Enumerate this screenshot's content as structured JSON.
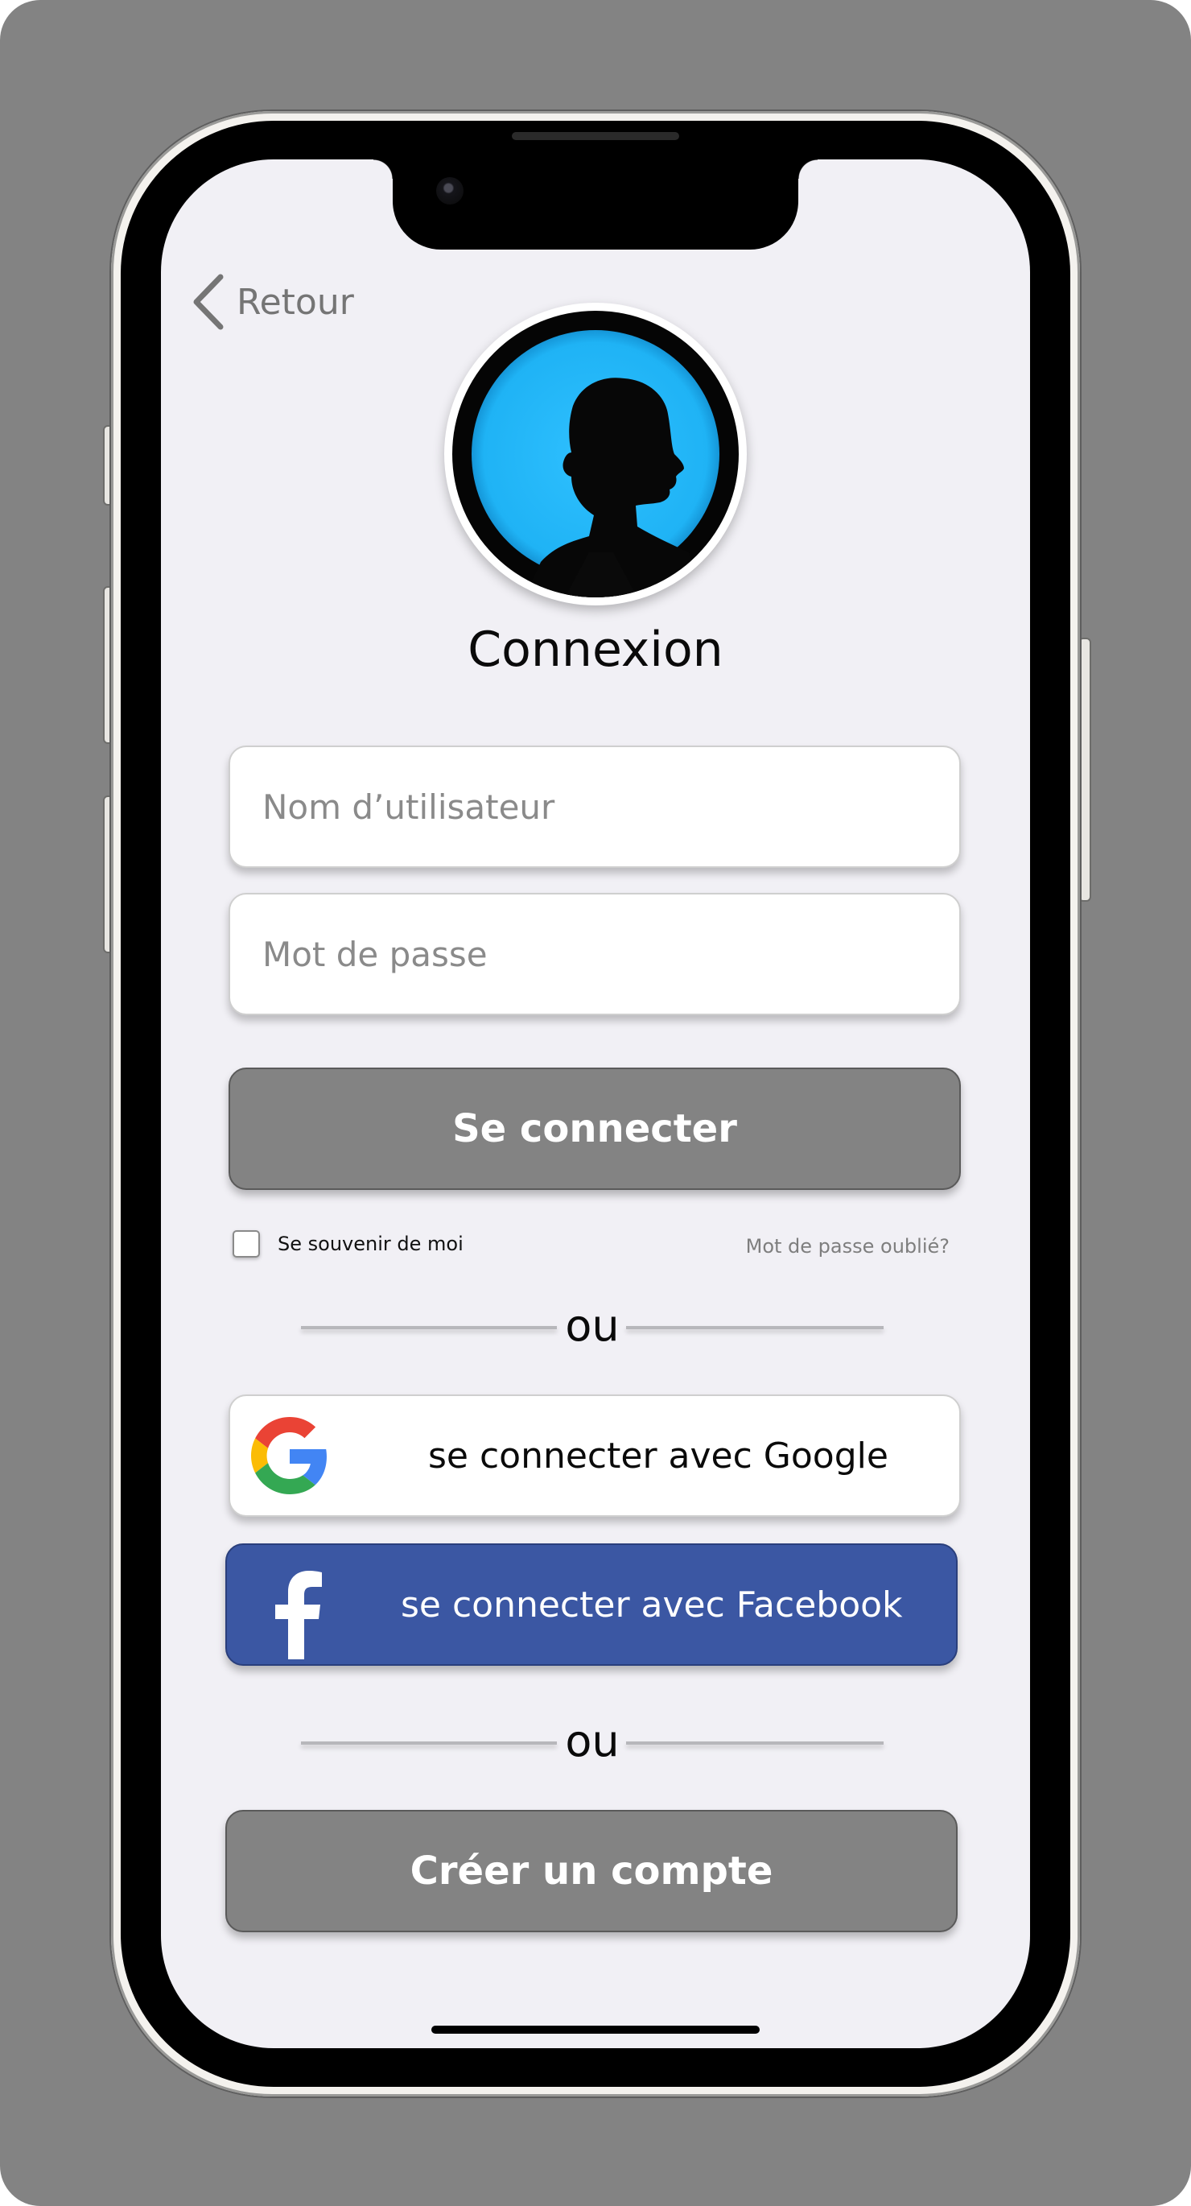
{
  "header": {
    "back_label": "Retour"
  },
  "page": {
    "title": "Connexion"
  },
  "form": {
    "username_placeholder": "Nom d’utilisateur",
    "password_placeholder": "Mot de passe",
    "login_label": "Se connecter",
    "remember_label": "Se souvenir de moi",
    "remember_checked": false,
    "forgot_label": "Mot de passe oublié?"
  },
  "dividers": {
    "first": "ou",
    "second": "ou"
  },
  "social": {
    "google_label": "se connecter avec Google",
    "facebook_label": "se connecter avec Facebook"
  },
  "signup": {
    "label": "Créer un compte"
  },
  "colors": {
    "background": "#838383",
    "screen": "#f1f0f5",
    "primary_button": "#838383",
    "facebook": "#3b57a3",
    "avatar_glow": "#1fb3f5"
  },
  "icons": [
    "chevron-left-icon",
    "user-silhouette-icon",
    "google-logo-icon",
    "facebook-logo-icon"
  ]
}
